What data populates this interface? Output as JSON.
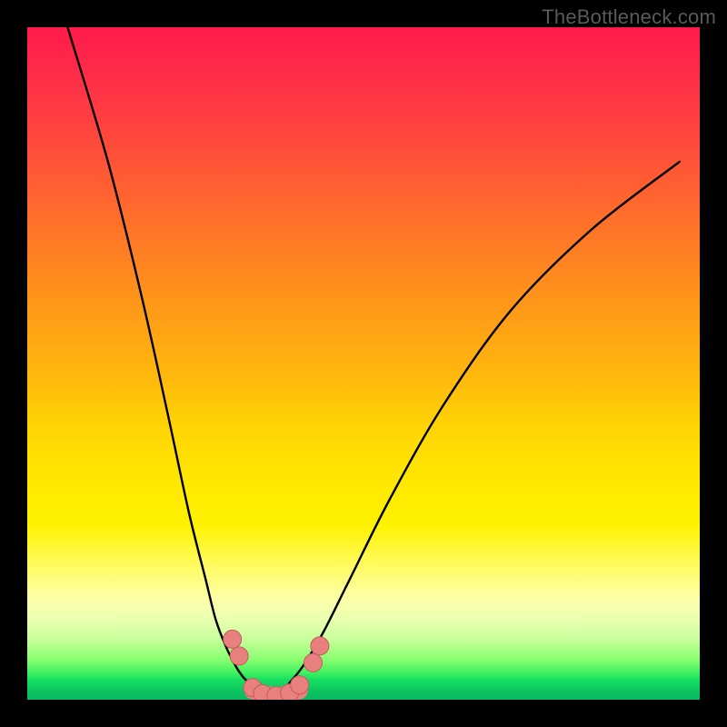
{
  "watermark": "TheBottleneck.com",
  "colors": {
    "gradient_top": "#ff1a4a",
    "gradient_mid": "#ffe800",
    "gradient_bottom": "#08b860",
    "frame": "#000000",
    "curve": "#000000",
    "marker_fill": "#e98080",
    "marker_stroke": "#c85a5a"
  },
  "chart_data": {
    "type": "line",
    "title": "",
    "xlabel": "",
    "ylabel": "",
    "xlim": [
      0,
      100
    ],
    "ylim": [
      0,
      100
    ],
    "grid": false,
    "series": [
      {
        "name": "left-branch",
        "x": [
          6,
          12,
          17,
          21,
          24,
          26.5,
          28,
          29.5,
          31,
          32,
          33,
          34,
          35,
          36,
          37
        ],
        "values": [
          100,
          80,
          60,
          42,
          28,
          18,
          12,
          8,
          5,
          3.5,
          2.5,
          1.8,
          1.2,
          0.8,
          0.6
        ]
      },
      {
        "name": "right-branch",
        "x": [
          37,
          38,
          39,
          41,
          44,
          48,
          54,
          62,
          72,
          84,
          97
        ],
        "values": [
          0.6,
          1.2,
          2.5,
          5,
          10,
          18,
          30,
          44,
          58,
          70,
          80
        ]
      }
    ],
    "markers": [
      {
        "x": 30.5,
        "y": 9
      },
      {
        "x": 31.5,
        "y": 6.5
      },
      {
        "x": 33.5,
        "y": 1.8
      },
      {
        "x": 35.0,
        "y": 0.9
      },
      {
        "x": 37.0,
        "y": 0.6
      },
      {
        "x": 39.0,
        "y": 1.0
      },
      {
        "x": 40.5,
        "y": 2.2
      },
      {
        "x": 42.5,
        "y": 5.5
      },
      {
        "x": 43.5,
        "y": 8
      }
    ],
    "bottom_band": {
      "x_start": 33.5,
      "x_end": 40.5,
      "y": 0.6
    }
  }
}
